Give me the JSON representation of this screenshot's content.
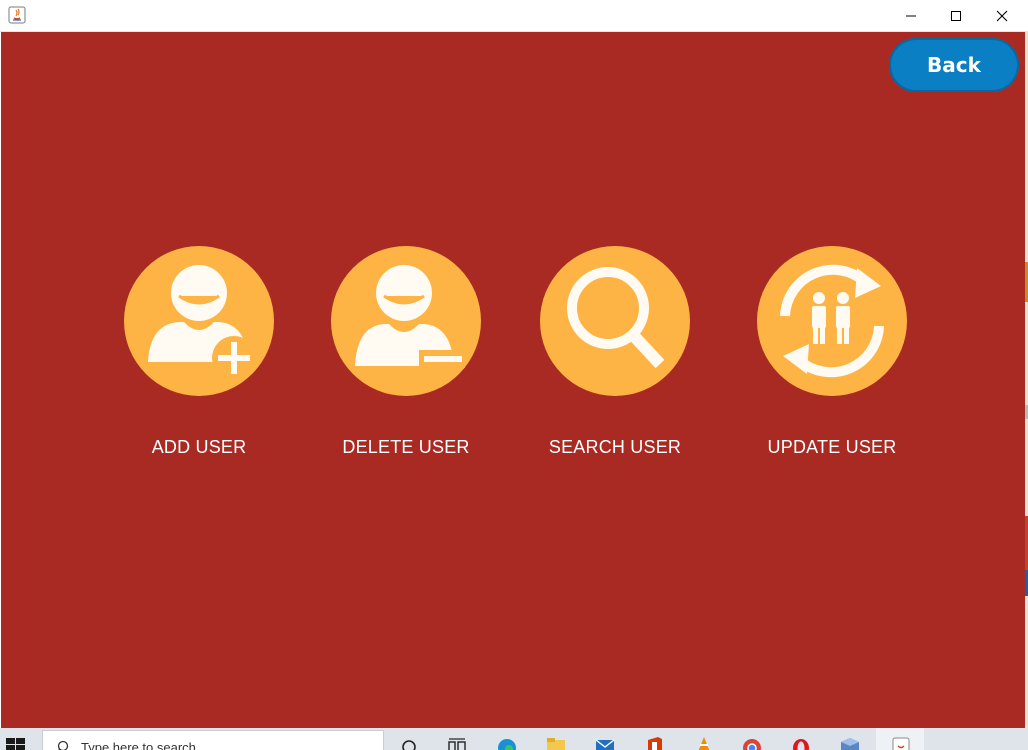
{
  "window": {
    "controls": [
      "minimize-icon",
      "maximize-icon",
      "close-icon"
    ]
  },
  "header": {
    "back_label": "Back"
  },
  "actions": [
    {
      "label": "ADD USER",
      "icon": "add-user-icon"
    },
    {
      "label": "DELETE USER",
      "icon": "delete-user-icon"
    },
    {
      "label": "SEARCH USER",
      "icon": "search-user-icon"
    },
    {
      "label": "UPDATE USER",
      "icon": "update-user-icon"
    }
  ],
  "taskbar": {
    "search_placeholder": "Type here to search",
    "apps": [
      "search-icon",
      "task-view-icon",
      "edge-icon",
      "file-explorer-icon",
      "mail-icon",
      "office-icon",
      "vlc-icon",
      "chrome-icon",
      "opera-icon",
      "virtualbox-icon",
      "java-icon"
    ]
  },
  "colors": {
    "panel_bg": "#a82a22",
    "icon_circle": "#fdb444",
    "back_button": "#0a7fc4",
    "label_text": "#ffffff"
  }
}
